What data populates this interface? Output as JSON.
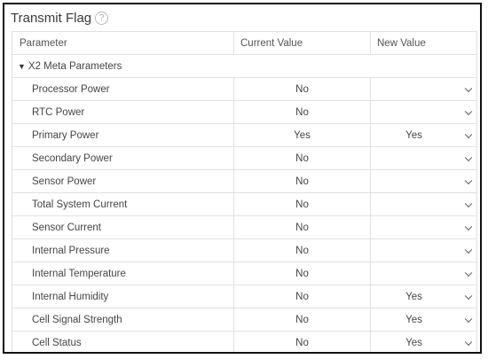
{
  "panel": {
    "title": "Transmit Flag",
    "help_glyph": "?"
  },
  "table": {
    "columns": [
      "Parameter",
      "Current Value",
      "New Value"
    ],
    "group": {
      "toggle_glyph": "▼",
      "label": "X2 Meta Parameters"
    },
    "rows": [
      {
        "parameter": "Processor Power",
        "current": "No",
        "new": ""
      },
      {
        "parameter": "RTC Power",
        "current": "No",
        "new": ""
      },
      {
        "parameter": "Primary Power",
        "current": "Yes",
        "new": "Yes"
      },
      {
        "parameter": "Secondary Power",
        "current": "No",
        "new": ""
      },
      {
        "parameter": "Sensor Power",
        "current": "No",
        "new": ""
      },
      {
        "parameter": "Total System Current",
        "current": "No",
        "new": ""
      },
      {
        "parameter": "Sensor Current",
        "current": "No",
        "new": ""
      },
      {
        "parameter": "Internal Pressure",
        "current": "No",
        "new": ""
      },
      {
        "parameter": "Internal Temperature",
        "current": "No",
        "new": ""
      },
      {
        "parameter": "Internal Humidity",
        "current": "No",
        "new": "Yes"
      },
      {
        "parameter": "Cell Signal Strength",
        "current": "No",
        "new": "Yes"
      },
      {
        "parameter": "Cell Status",
        "current": "No",
        "new": "Yes"
      }
    ]
  }
}
